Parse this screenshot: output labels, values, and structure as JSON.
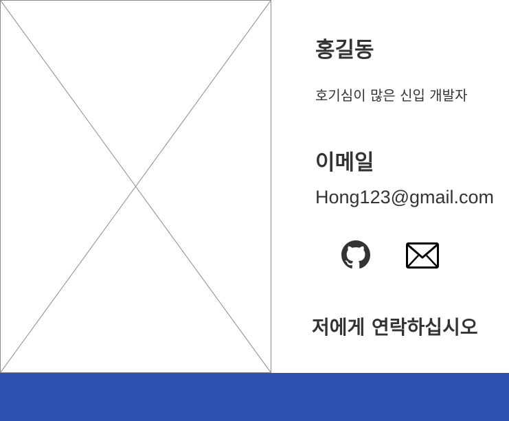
{
  "profile": {
    "name": "홍길동",
    "tagline": "호기심이 많은 신입 개발자"
  },
  "contact": {
    "email_heading": "이메일",
    "email": "Hong123@gmail.com",
    "links": [
      {
        "icon": "github-icon"
      },
      {
        "icon": "envelope-icon"
      }
    ],
    "cta_label": "저에게 연락하십시오"
  },
  "colors": {
    "text": "#333333",
    "footer": "#2e50b1",
    "placeholder_border": "#8a8a8a"
  }
}
